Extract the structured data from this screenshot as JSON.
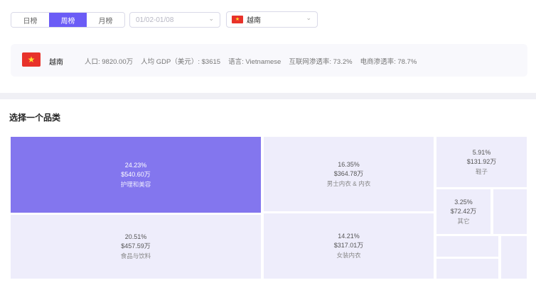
{
  "tabs": [
    {
      "label": "日榜",
      "active": false
    },
    {
      "label": "周榜",
      "active": true
    },
    {
      "label": "月榜",
      "active": false
    }
  ],
  "date_range": {
    "value": "01/02-01/08"
  },
  "country_select": {
    "value": "越南",
    "flag": "vietnam-flag-icon"
  },
  "info": {
    "country": "越南",
    "population": "人口: 9820.00万",
    "gdp": "人均 GDP（美元）: $3615",
    "language": "语言: Vietnamese",
    "internet": "互联网渗透率: 73.2%",
    "ecommerce": "电商渗透率: 78.7%"
  },
  "section_title": "选择一个品类",
  "categories": [
    {
      "pct": "24.23%",
      "amount": "$540.60万",
      "name": "护理和美容",
      "active": true
    },
    {
      "pct": "20.51%",
      "amount": "$457.59万",
      "name": "食品与饮料",
      "active": false
    },
    {
      "pct": "16.35%",
      "amount": "$364.78万",
      "name": "男士内衣 & 内衣",
      "active": false
    },
    {
      "pct": "14.21%",
      "amount": "$317.01万",
      "name": "女装内衣",
      "active": false
    },
    {
      "pct": "5.91%",
      "amount": "$131.92万",
      "name": "鞋子",
      "active": false
    },
    {
      "pct": "3.25%",
      "amount": "$72.42万",
      "name": "其它",
      "active": false
    }
  ],
  "colors": {
    "accent": "#6b5cf6",
    "tile_active": "#8376ee",
    "tile": "#eeedfb",
    "flag_red": "#e8322a",
    "flag_star": "#ffdf2e"
  }
}
